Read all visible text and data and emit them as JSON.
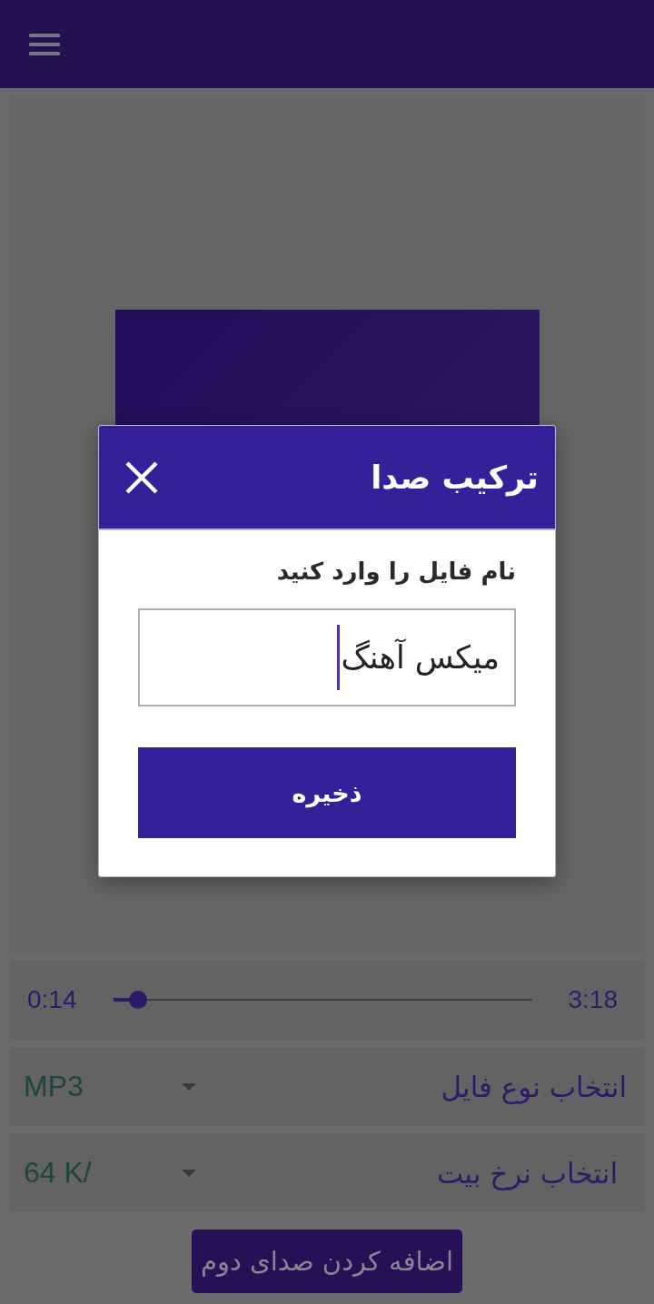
{
  "player": {
    "seek": {
      "elapsed": "0:14",
      "total": "3:18",
      "level": 0.06
    }
  },
  "settings": [
    {
      "label": "انتخاب نوع فایل",
      "value": "MP3"
    },
    {
      "label": "انتخاب نرخ بیت",
      "value": "64 K/"
    }
  ],
  "add_button": "اضافه کردن صدای دوم",
  "dialog": {
    "title": "ترکیب صدا",
    "prompt": "نام فایل را وارد کنید",
    "field_value": "میکس آهنگ",
    "save_button": "ذخیره"
  }
}
